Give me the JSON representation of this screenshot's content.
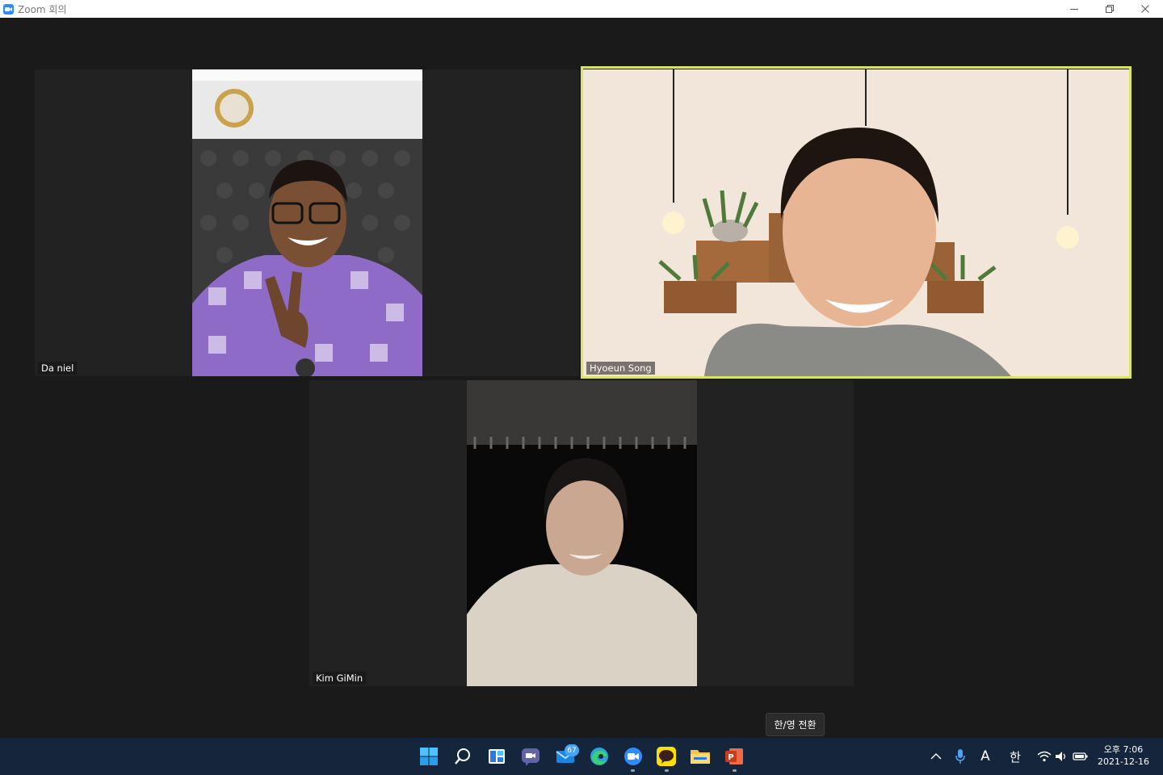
{
  "window": {
    "title": "Zoom 회의"
  },
  "participants": [
    {
      "name": "Da niel"
    },
    {
      "name": "Hyoeun Song"
    },
    {
      "name": "Kim GiMin"
    }
  ],
  "tooltip": {
    "text": "한/영 전환"
  },
  "taskbar": {
    "apps": [
      "windows-start",
      "search",
      "widgets",
      "teams-chat",
      "mail",
      "edge",
      "zoom",
      "kakaotalk",
      "file-explorer",
      "powerpoint"
    ],
    "mail_badge": "67",
    "kakao_label": "TALK"
  },
  "tray": {
    "ime_mode": "A",
    "ime_lang": "한",
    "time": "오후 7:06",
    "date": "2021-12-16"
  },
  "colors": {
    "background": "#1a1a1a",
    "taskbar": "#15253b",
    "active_speaker_border": "#d8e462",
    "zoom_blue": "#2d8cff"
  }
}
